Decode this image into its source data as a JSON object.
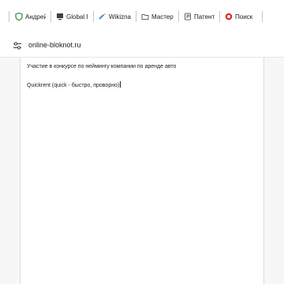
{
  "bookmarks": [
    {
      "label": "Андрей",
      "icon": "shield-icon"
    },
    {
      "label": "Global I",
      "icon": "monitor-icon"
    },
    {
      "label": "Wikizna",
      "icon": "pen-icon"
    },
    {
      "label": "Мастер",
      "icon": "folder-icon"
    },
    {
      "label": "Патент",
      "icon": "patent-icon"
    },
    {
      "label": "Поиск",
      "icon": "search-logo-icon"
    }
  ],
  "address": {
    "url": "online-bloknot.ru",
    "icon": "site-settings-icon"
  },
  "editor": {
    "line1": "Участие в конкурсе по неймингу компании по аренде авто",
    "line2": "Quickrent (quick - быстро, проворно)"
  },
  "colors": {
    "accent_green": "#1e8e3e",
    "accent_blue": "#1a73e8",
    "accent_red": "#d93025"
  }
}
